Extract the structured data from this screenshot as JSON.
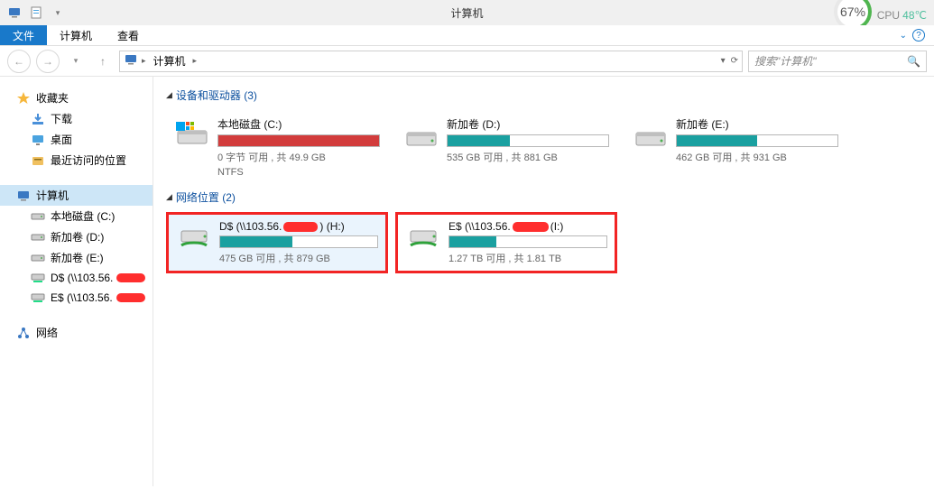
{
  "window": {
    "title": "计算机",
    "cpu_pct": "67%",
    "cpu_label": "CPU",
    "cpu_temp": "48℃"
  },
  "ribbon": {
    "tabs": [
      "文件",
      "计算机",
      "查看"
    ],
    "active_index": 0
  },
  "nav": {
    "breadcrumb_root": "计算机",
    "search_placeholder": "搜索\"计算机\""
  },
  "sidebar": {
    "favorites": {
      "label": "收藏夹",
      "items": [
        "下载",
        "桌面",
        "最近访问的位置"
      ]
    },
    "computer": {
      "label": "计算机",
      "items": [
        {
          "label": "本地磁盘 (C:)",
          "type": "local"
        },
        {
          "label": "新加卷 (D:)",
          "type": "local"
        },
        {
          "label": "新加卷 (E:)",
          "type": "local"
        },
        {
          "label": "D$ (\\\\103.56.",
          "type": "net",
          "redacted": true
        },
        {
          "label": "E$ (\\\\103.56.",
          "type": "net",
          "redacted": true
        }
      ]
    },
    "network": {
      "label": "网络"
    }
  },
  "content": {
    "sections": [
      {
        "title": "设备和驱动器 (3)",
        "drives": [
          {
            "name": "本地磁盘 (C:)",
            "stat": "0 字节 可用 , 共 49.9 GB",
            "extra": "NTFS",
            "fill_pct": 100,
            "full": true,
            "type": "local-c"
          },
          {
            "name": "新加卷 (D:)",
            "stat": "535 GB 可用 , 共 881 GB",
            "fill_pct": 39,
            "type": "local"
          },
          {
            "name": "新加卷 (E:)",
            "stat": "462 GB 可用 , 共 931 GB",
            "fill_pct": 50,
            "type": "local"
          }
        ]
      },
      {
        "title": "网络位置 (2)",
        "drives": [
          {
            "name_prefix": "D$ (\\\\103.56.",
            "name_suffix": ") (H:)",
            "redacted_mid": true,
            "stat": "475 GB 可用 , 共 879 GB",
            "fill_pct": 46,
            "type": "net",
            "highlight": true,
            "selected": true
          },
          {
            "name_prefix": "E$ (\\\\103.56.",
            "name_suffix": " (I:)",
            "redacted_mid": true,
            "stat": "1.27 TB 可用 , 共 1.81 TB",
            "fill_pct": 30,
            "type": "net",
            "highlight": true
          }
        ]
      }
    ]
  }
}
